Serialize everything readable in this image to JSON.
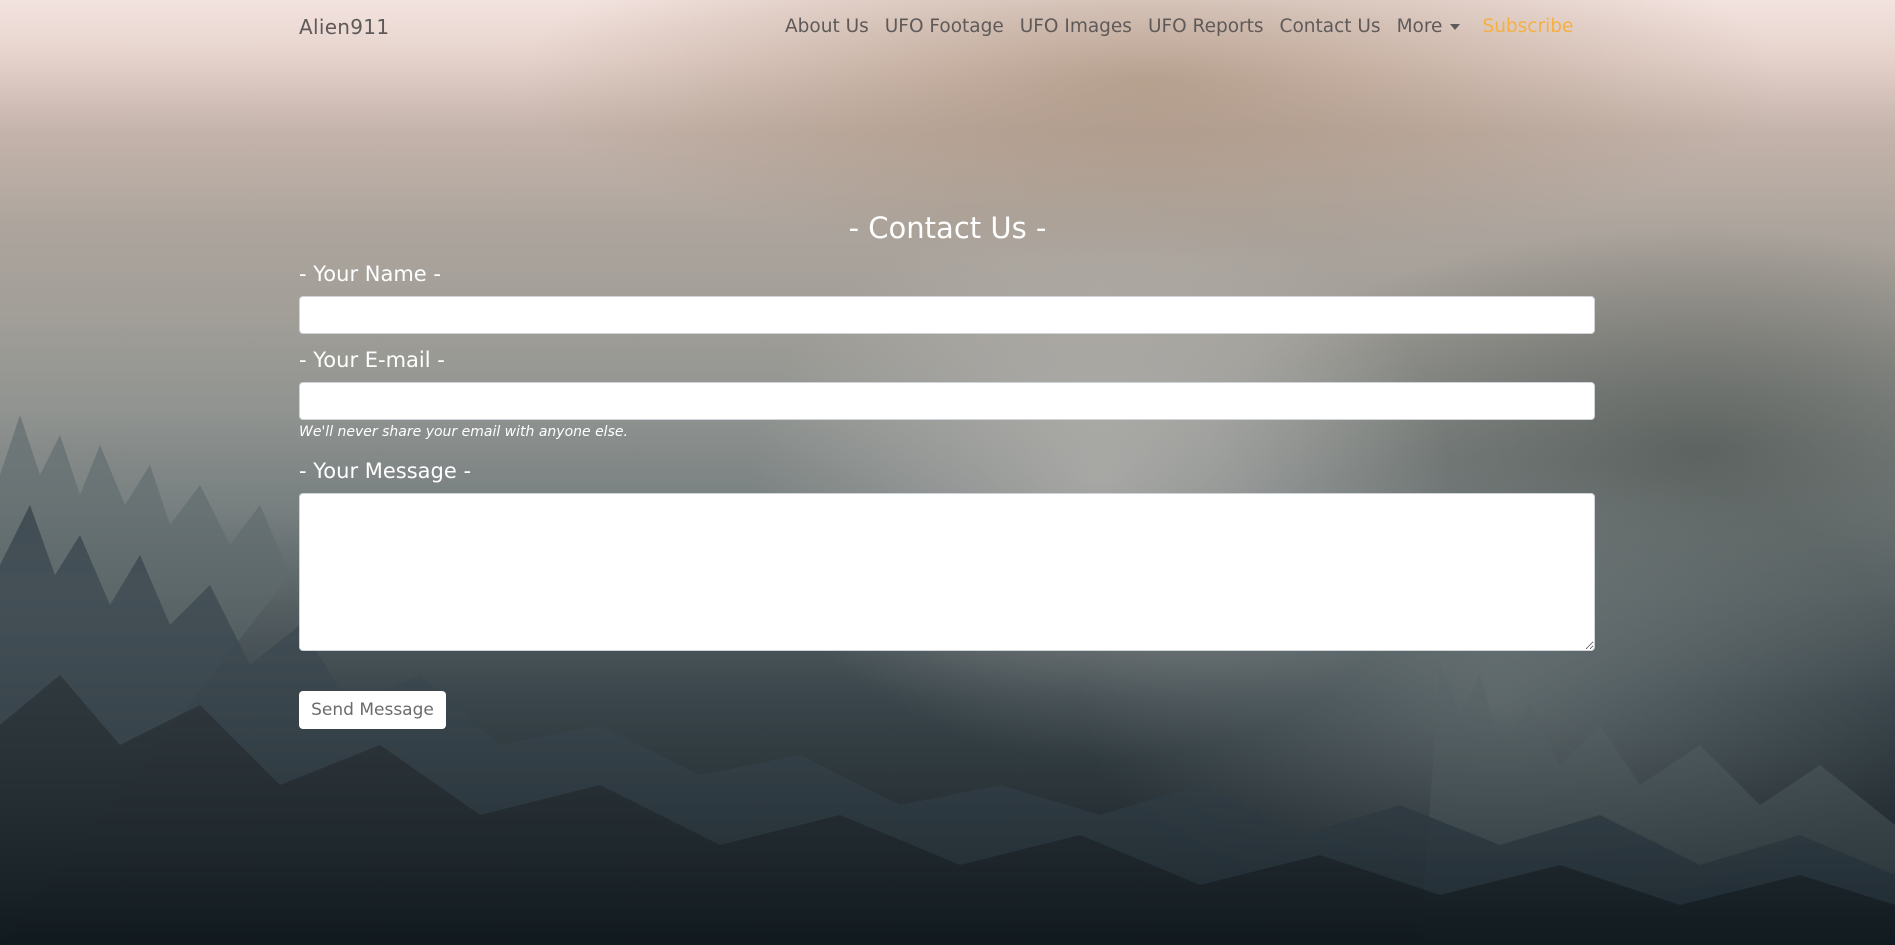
{
  "navbar": {
    "brand": "Alien911",
    "links": [
      {
        "label": "About Us"
      },
      {
        "label": "UFO Footage"
      },
      {
        "label": "UFO Images"
      },
      {
        "label": "UFO Reports"
      },
      {
        "label": "Contact Us"
      }
    ],
    "more": {
      "label": "More",
      "icon": "caret-down-icon"
    },
    "subscribe": {
      "label": "Subscribe",
      "color": "#f5b041"
    }
  },
  "page": {
    "title": "- Contact Us -"
  },
  "form": {
    "name": {
      "label": "- Your Name -",
      "value": "",
      "placeholder": ""
    },
    "email": {
      "label": "- Your E-mail -",
      "value": "",
      "placeholder": "",
      "help": "We'll never share your email with anyone else."
    },
    "message": {
      "label": "- Your Message -",
      "value": "",
      "placeholder": ""
    },
    "submit_label": "Send Message"
  },
  "background": {
    "description": "misty pine forest"
  }
}
